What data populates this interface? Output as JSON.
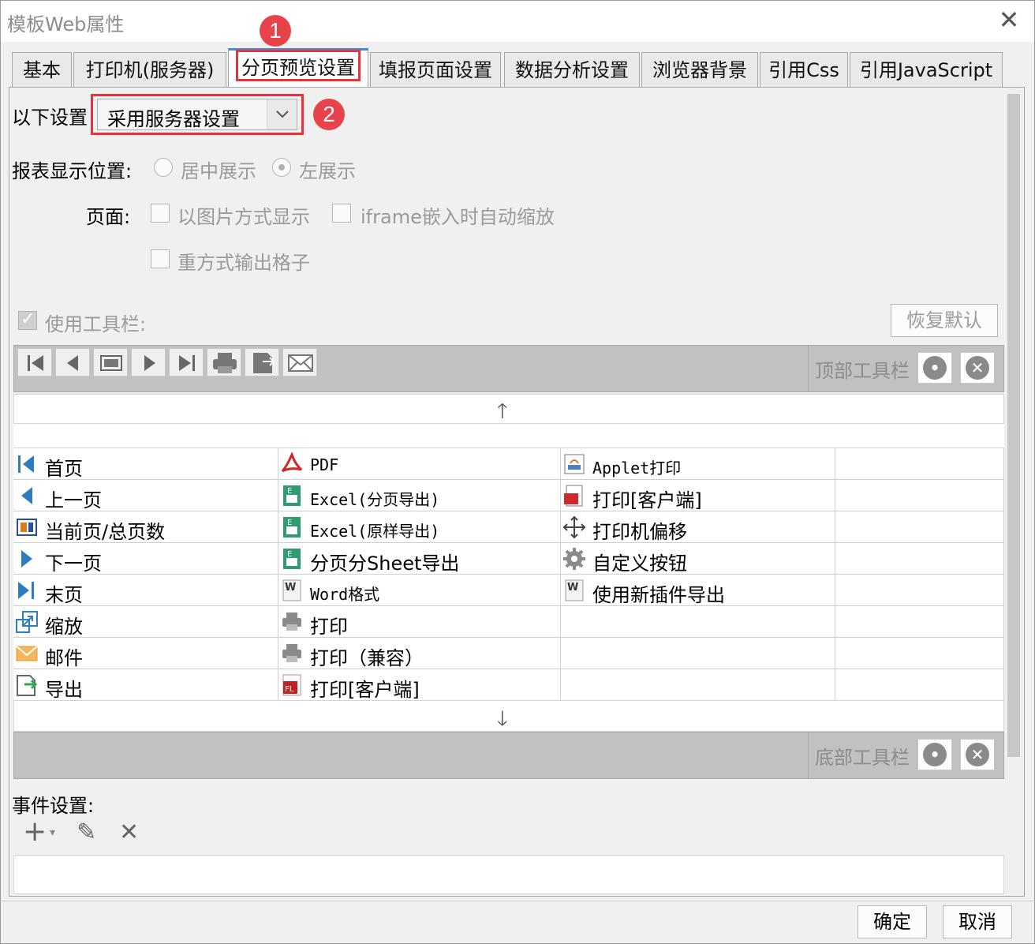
{
  "window": {
    "title": "模板Web属性",
    "close_glyph": "✕"
  },
  "tabs": [
    {
      "label": "基本",
      "active": false
    },
    {
      "label": "打印机(服务器)",
      "active": false
    },
    {
      "label": "分页预览设置",
      "active": true
    },
    {
      "label": "填报页面设置",
      "active": false
    },
    {
      "label": "数据分析设置",
      "active": false
    },
    {
      "label": "浏览器背景",
      "active": false
    },
    {
      "label": "引用Css",
      "active": false
    },
    {
      "label": "引用JavaScript",
      "active": false
    }
  ],
  "callouts": {
    "one": "1",
    "two": "2"
  },
  "settings": {
    "label": "以下设置",
    "select_value": "采用服务器设置"
  },
  "display_position": {
    "label": "报表显示位置:",
    "option_center": "居中展示",
    "option_left": "左展示",
    "selected": "左展示"
  },
  "page_options": {
    "label": "页面:",
    "as_image": "以图片方式显示",
    "iframe_zoom": "iframe嵌入时自动缩放",
    "repeat_cells": "重方式输出格子"
  },
  "toolbar_section": {
    "use_toolbar": "使用工具栏:",
    "use_toolbar_checked": true,
    "restore_default": "恢复默认",
    "top_toolbar": "顶部工具栏",
    "bottom_toolbar": "底部工具栏",
    "up_arrow": "🡑",
    "down_arrow": "🡓",
    "settings_glyph": "•",
    "remove_glyph": "✕"
  },
  "top_toolbar_icons": [
    "first-page-icon",
    "prev-page-icon",
    "page-number-icon",
    "next-page-icon",
    "last-page-icon",
    "print-icon",
    "export-icon",
    "email-icon"
  ],
  "grid": {
    "col1": [
      "首页",
      "上一页",
      "当前页/总页数",
      "下一页",
      "末页",
      "缩放",
      "邮件",
      "导出"
    ],
    "col2": [
      "PDF",
      "Excel(分页导出)",
      "Excel(原样导出)",
      "分页分Sheet导出",
      "Word格式",
      "打印",
      "打印（兼容）",
      "打印[客户端]"
    ],
    "col3": [
      "Applet打印",
      "打印[客户端]",
      "打印机偏移",
      "自定义按钮",
      "使用新插件导出",
      "",
      "",
      ""
    ],
    "col4": [
      "",
      "",
      "",
      "",
      "",
      "",
      "",
      ""
    ]
  },
  "events": {
    "label": "事件设置:",
    "add_glyph": "+",
    "edit_glyph": "✎",
    "delete_glyph": "✕"
  },
  "footer": {
    "ok": "确定",
    "cancel": "取消"
  }
}
